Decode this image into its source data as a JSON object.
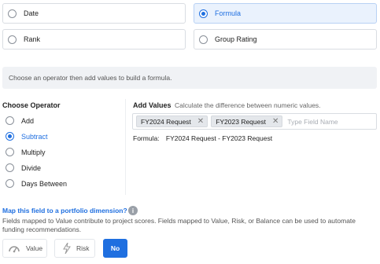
{
  "field_types": [
    {
      "label": "Date",
      "selected": false
    },
    {
      "label": "Formula",
      "selected": true
    },
    {
      "label": "Rank",
      "selected": false
    },
    {
      "label": "Group Rating",
      "selected": false
    }
  ],
  "hint": "Choose an operator then add values to build a formula.",
  "operator": {
    "title": "Choose Operator",
    "options": [
      "Add",
      "Subtract",
      "Multiply",
      "Divide",
      "Days Between"
    ],
    "selected": "Subtract"
  },
  "values": {
    "title": "Add Values",
    "description": "Calculate the difference between numeric values.",
    "chips": [
      "FY2024 Request",
      "FY2023 Request"
    ],
    "placeholder": "Type Field Name"
  },
  "formula": {
    "label": "Formula:",
    "expression": "FY2024 Request - FY2023 Request"
  },
  "portfolio": {
    "link": "Map this field to a portfolio dimension?",
    "info_icon": "i",
    "description": "Fields mapped to Value contribute to project scores. Fields mapped to Value, Risk, or Balance can be used to automate funding recommendations.",
    "buttons": [
      {
        "label": "Value",
        "icon": "gauge-icon"
      },
      {
        "label": "Risk",
        "icon": "lightning-icon"
      },
      {
        "label": "No",
        "active": true
      }
    ]
  },
  "colors": {
    "accent": "#1f6fe0",
    "selected_card_bg": "#eaf2fd",
    "hint_bg": "#f0f2f5"
  }
}
